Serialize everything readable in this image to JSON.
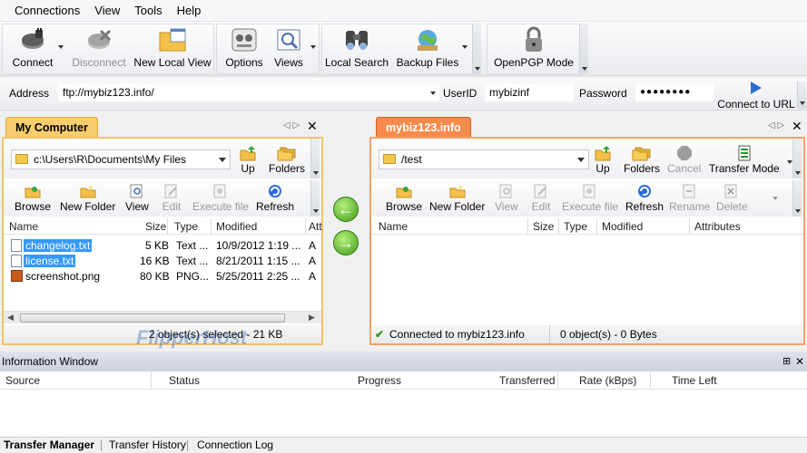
{
  "menu": {
    "items": [
      "Connections",
      "View",
      "Tools",
      "Help"
    ]
  },
  "toolbar": {
    "connect": "Connect",
    "disconnect": "Disconnect",
    "new_local_view": "New Local View",
    "options": "Options",
    "views": "Views",
    "local_search": "Local Search",
    "backup_files": "Backup Files",
    "openpgp_mode": "OpenPGP Mode"
  },
  "address_bar": {
    "address_label": "Address",
    "address_value": "ftp://mybiz123.info/",
    "userid_label": "UserID",
    "userid_value": "mybizinf",
    "password_label": "Password",
    "password_value": "●●●●●●●●",
    "connect_to_url": "Connect to URL"
  },
  "left_panel": {
    "tab_title": "My Computer",
    "path": "c:\\Users\\R\\Documents\\My Files",
    "up": "Up",
    "folders": "Folders",
    "actions": {
      "browse": "Browse",
      "new_folder": "New Folder",
      "view": "View",
      "edit": "Edit",
      "execute_file": "Execute file",
      "refresh": "Refresh"
    },
    "columns": [
      "Name",
      "Size",
      "Type",
      "Modified",
      "Att"
    ],
    "files": [
      {
        "name": "changelog.txt",
        "size": "5 KB",
        "type": "Text ...",
        "modified": "10/9/2012 1:19 ...",
        "att": "A"
      },
      {
        "name": "license.txt",
        "size": "16 KB",
        "type": "Text ...",
        "modified": "8/21/2011 1:15 ...",
        "att": "A"
      },
      {
        "name": "screenshot.png",
        "size": "80 KB",
        "type": "PNG...",
        "modified": "5/25/2011 2:25 ...",
        "att": "A"
      }
    ],
    "status": "2 object(s) selected - 21 KB"
  },
  "right_panel": {
    "tab_title": "mybiz123.info",
    "path": "/test",
    "up": "Up",
    "folders": "Folders",
    "cancel": "Cancel",
    "transfer_mode": "Transfer Mode",
    "actions": {
      "browse": "Browse",
      "new_folder": "New Folder",
      "view": "View",
      "edit": "Edit",
      "execute_file": "Execute file",
      "refresh": "Refresh",
      "rename": "Rename",
      "delete": "Delete"
    },
    "columns": [
      "Name",
      "Size",
      "Type",
      "Modified",
      "Attributes"
    ],
    "status_connected": "Connected to mybiz123.info",
    "status_objects": "0 object(s) - 0 Bytes"
  },
  "info_window": {
    "title": "Information Window",
    "columns": [
      "Source",
      "Status",
      "Progress",
      "Transferred",
      "Rate (kBps)",
      "Time Left"
    ],
    "tabs": [
      "Transfer Manager",
      "Transfer History",
      "Connection Log"
    ]
  },
  "watermark": "FlipperHost",
  "colors": {
    "left_border": "#f2c462",
    "right_border": "#f3a16d",
    "selection": "#3399ff",
    "arrow_green": "#3f9a1c"
  }
}
